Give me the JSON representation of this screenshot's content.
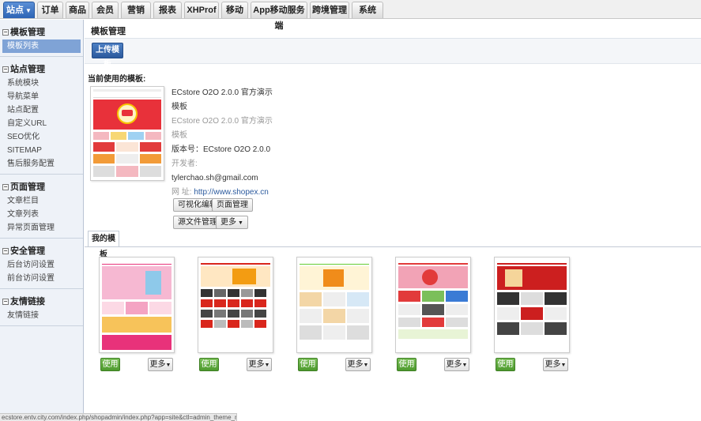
{
  "topnav": {
    "tabs": [
      {
        "label": "站点",
        "active": true
      },
      {
        "label": "订单"
      },
      {
        "label": "商品"
      },
      {
        "label": "会员"
      },
      {
        "label": "营销"
      },
      {
        "label": "报表"
      },
      {
        "label": "XHProf"
      },
      {
        "label": "移动"
      },
      {
        "label": "App移动服务端"
      },
      {
        "label": "跨境管理"
      },
      {
        "label": "系统"
      }
    ]
  },
  "sidebar": {
    "groups": [
      {
        "title": "模板管理",
        "items": [
          "模板列表"
        ]
      },
      {
        "title": "站点管理",
        "items": [
          "系统模块",
          "导航菜单",
          "站点配置",
          "自定义URL",
          "SEO优化",
          "SITEMAP",
          "售后服务配置"
        ]
      },
      {
        "title": "页面管理",
        "items": [
          "文章栏目",
          "文章列表",
          "异常页面管理"
        ]
      },
      {
        "title": "安全管理",
        "items": [
          "后台访问设置",
          "前台访问设置"
        ]
      },
      {
        "title": "友情链接",
        "items": [
          "友情链接"
        ]
      }
    ]
  },
  "main": {
    "title": "模板管理",
    "upload_label": "上传模板",
    "current_label": "当前使用的模板:",
    "current": {
      "name_line1": "ECstore O2O 2.0.0 官方演示",
      "name_line2": "模板",
      "desc_line1": "ECstore O2O 2.0.0 官方演示",
      "desc_line2": "模板",
      "version": "版本号：ECstore O2O 2.0.0",
      "developer_label": "开发者:",
      "developer_email": "tylerchao.sh@gmail.com",
      "url_label": "网    址:",
      "url": "http://www.shopex.cn",
      "buttons": {
        "visual_edit": "可视化编辑",
        "page_manage": "页面管理",
        "source_manage": "源文件管理",
        "more": "更多"
      }
    },
    "my_tab_label": "我的模板",
    "templates": [
      {
        "use": "使用",
        "more": "更多",
        "accent": "#e8327a"
      },
      {
        "use": "使用",
        "more": "更多",
        "accent": "#d9261c"
      },
      {
        "use": "使用",
        "more": "更多",
        "accent": "#f08c1a"
      },
      {
        "use": "使用",
        "more": "更多",
        "accent": "#e23b3b"
      },
      {
        "use": "使用",
        "more": "更多",
        "accent": "#cc1f1f"
      }
    ]
  },
  "status_url": "ecstore.entv.city.com/index.php/shopadmin/index.php?app=site&ctl=admin_theme_man"
}
